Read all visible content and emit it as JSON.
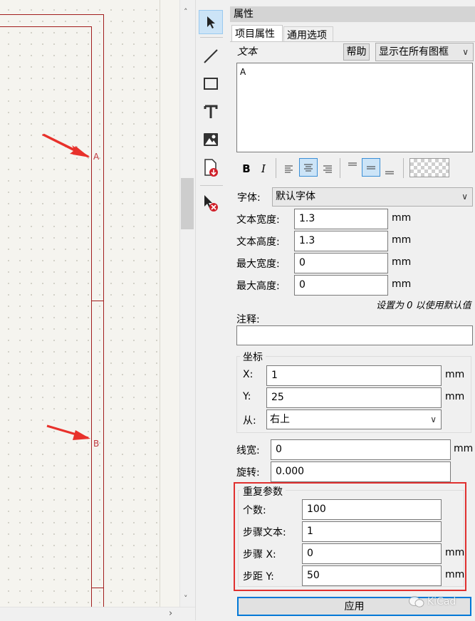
{
  "canvas": {
    "zone_a": "A",
    "zone_b": "B"
  },
  "toolbar": {
    "tools": [
      "select-tool",
      "line-tool",
      "rectangle-tool",
      "text-tool",
      "image-tool",
      "import-tool",
      "delete-tool"
    ]
  },
  "panel": {
    "title": "属性",
    "tabs": [
      "项目属性",
      "通用选项"
    ],
    "text_label": "文本",
    "help_button": "帮助",
    "visibility_select": "显示在所有图框",
    "text_value": "A",
    "format": {
      "bold": "B",
      "italic": "I",
      "h_align_selected": "center",
      "v_align_selected": "center"
    },
    "font_label": "字体:",
    "font_value": "默认字体",
    "text_width_label": "文本宽度:",
    "text_width_value": "1.3",
    "text_height_label": "文本高度:",
    "text_height_value": "1.3",
    "max_width_label": "最大宽度:",
    "max_width_value": "0",
    "max_height_label": "最大高度:",
    "max_height_value": "0",
    "unit": "mm",
    "default_hint": "设置为 0 以使用默认值",
    "comment_label": "注释:",
    "comment_value": "",
    "position_group": "坐标",
    "x_label": "X:",
    "x_value": "1",
    "y_label": "Y:",
    "y_value": "25",
    "from_label": "从:",
    "from_value": "右上",
    "line_width_label": "线宽:",
    "line_width_value": "0",
    "rotation_label": "旋转:",
    "rotation_value": "0.000",
    "repeat_group": "重复参数",
    "count_label": "个数:",
    "count_value": "100",
    "step_text_label": "步骤文本:",
    "step_text_value": "1",
    "step_x_label": "步骤 X:",
    "step_x_value": "0",
    "step_y_label": "步距 Y:",
    "step_y_value": "50",
    "apply_button": "应用",
    "watermark": "KiCad"
  },
  "colors": {
    "frame": "#a11d1d",
    "highlight": "#e0302f",
    "selection": "#cce4f7"
  }
}
